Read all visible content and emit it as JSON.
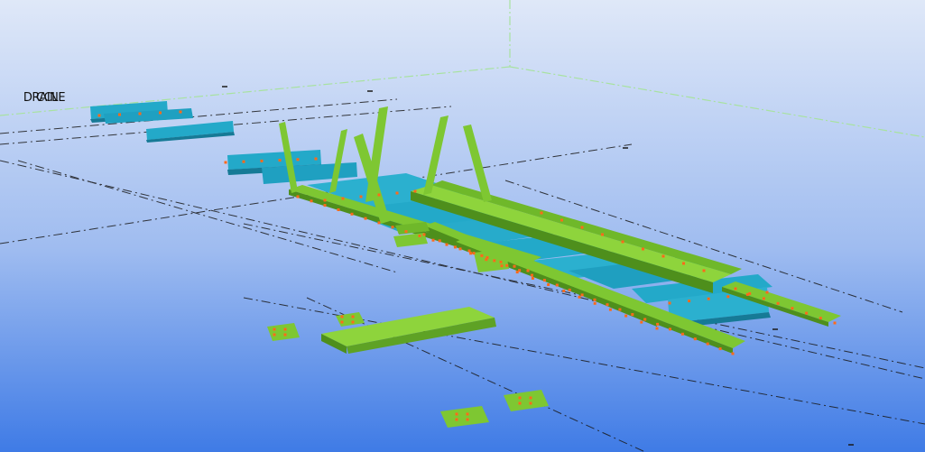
{
  "viewport": {
    "labels": [
      "CCL",
      "DRAINE"
    ],
    "background_top": "#dfe8f8",
    "background_bottom": "#3f7be6"
  },
  "colors": {
    "steel_green": "#7ec732",
    "steel_green_dark": "#4e8f1c",
    "steel_cyan": "#23a9c9",
    "steel_cyan_dark": "#167a96",
    "bolt_orange": "#ff6a1a",
    "grid_line": "#1a1a1a",
    "grid_boundary": "#a8e2a0"
  },
  "icons": [
    "bolt-marker-icon"
  ]
}
